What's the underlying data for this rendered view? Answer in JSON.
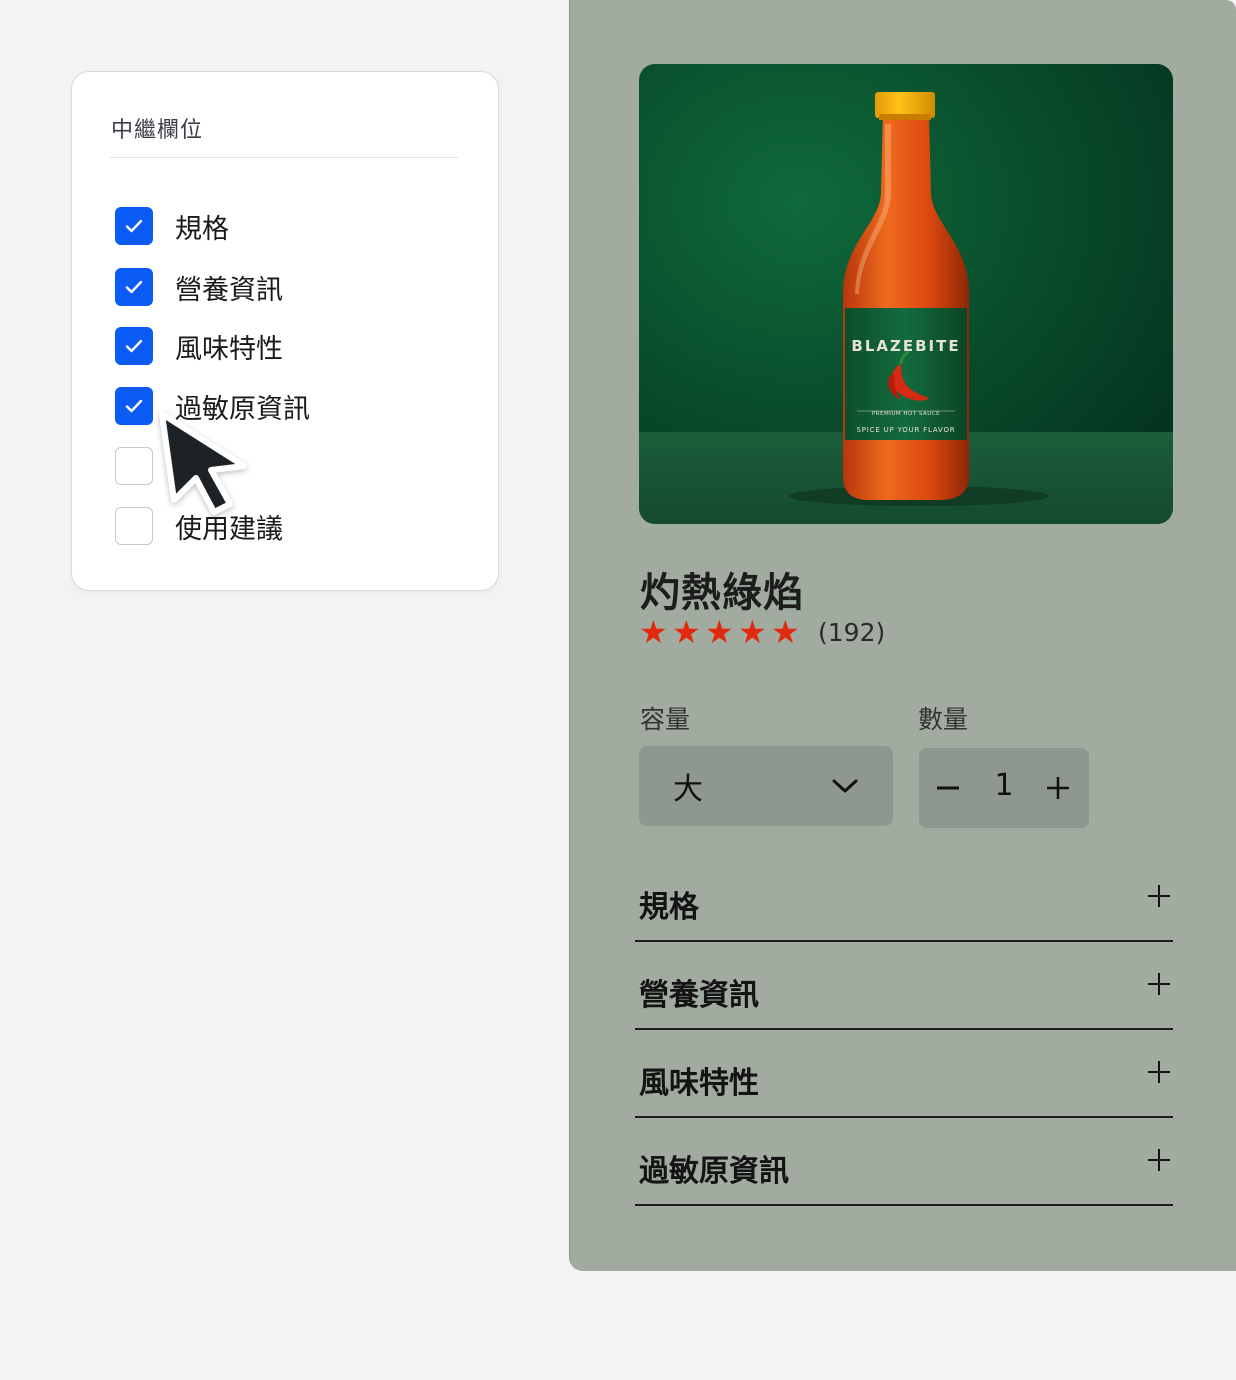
{
  "metafield_panel": {
    "title": "中繼欄位",
    "options": [
      {
        "label": "規格",
        "checked": true
      },
      {
        "label": "營養資訊",
        "checked": true
      },
      {
        "label": "風味特性",
        "checked": true
      },
      {
        "label": "過敏原資訊",
        "checked": true
      },
      {
        "label": "",
        "checked": false
      },
      {
        "label": "使用建議",
        "checked": false
      }
    ]
  },
  "product": {
    "image": {
      "brand": "BLAZEBITE",
      "subtitle": "PREMIUM HOT SAUCE",
      "tagline": "SPICE UP YOUR FLAVOR"
    },
    "title": "灼熱綠焰",
    "rating": 5,
    "review_count": "(192)",
    "size_label": "容量",
    "size_value": "大",
    "quantity_label": "數量",
    "quantity_value": "1",
    "accordions": [
      {
        "label": "規格"
      },
      {
        "label": "營養資訊"
      },
      {
        "label": "風味特性"
      },
      {
        "label": "過敏原資訊"
      }
    ]
  },
  "colors": {
    "checkbox_accent": "#0b5bf7",
    "star": "#e0290d",
    "product_bg": "#a1aba0",
    "control_bg": "#8f988e"
  }
}
